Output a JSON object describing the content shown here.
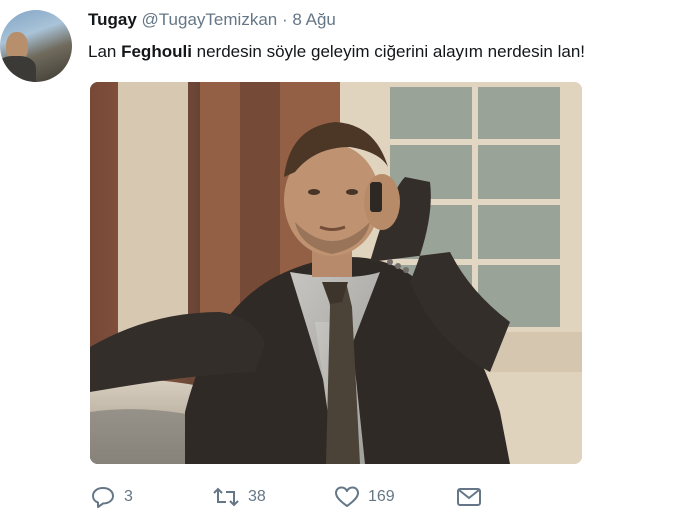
{
  "tweet": {
    "author_name": "Tugay",
    "author_handle": "@TugayTemizkan",
    "separator": "·",
    "date": "8 Ağu",
    "text_before": "Lan ",
    "text_bold": "Feghouli",
    "text_after": " nerdesin söyle geleyim ciğerini alayım nerdesin lan!",
    "media_description_icon": "photo-man-on-phone"
  },
  "actions": {
    "reply": {
      "icon": "reply-icon",
      "count": "3"
    },
    "retweet": {
      "icon": "retweet-icon",
      "count": "38"
    },
    "like": {
      "icon": "heart-icon",
      "count": "169"
    },
    "message": {
      "icon": "envelope-icon"
    }
  },
  "colors": {
    "text": "#14171a",
    "muted": "#657786"
  }
}
